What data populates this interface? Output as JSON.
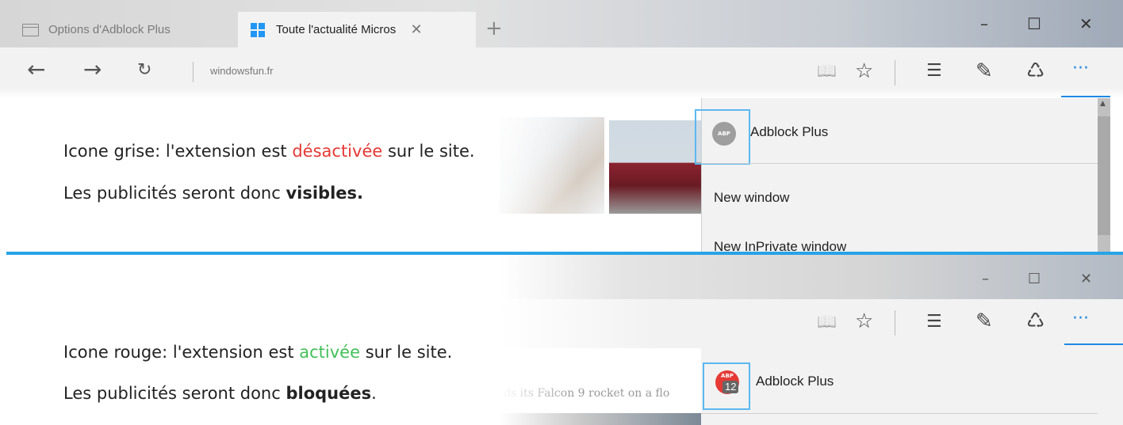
{
  "top_browser": {
    "tabs": [
      {
        "label": "Options d'Adblock Plus",
        "active": false
      },
      {
        "label": "Toute l'actualité Micros ",
        "active": true
      }
    ],
    "close_tab": "✕",
    "new_tab": "+",
    "window_controls": {
      "minimize": "–",
      "maximize": "☐",
      "close": "✕"
    },
    "nav": {
      "back": "←",
      "forward": "→",
      "refresh": "↻",
      "url": "windowsfun.fr"
    },
    "toolbar": {
      "reading_view": "📖",
      "favorite": "☆",
      "hub": "☰",
      "web_note": "✎",
      "share": "♺",
      "more": "···"
    }
  },
  "captions": {
    "top": {
      "line1_prefix": "Icone grise: l'extension est ",
      "line1_highlight": "désactivée",
      "line1_suffix": " sur le site.",
      "line2_prefix": "Les publicités seront donc ",
      "line2_bold": "visibles."
    },
    "bottom": {
      "line1_prefix": "Icone rouge: l'extension est ",
      "line1_highlight": "activée",
      "line1_suffix": " sur le site.",
      "line2_prefix": "Les publicités seront donc ",
      "line2_bold": "bloquées",
      "line2_suffix": "."
    }
  },
  "top_menu": {
    "extension_label": "Adblock Plus",
    "abp_icon_text": "ABP",
    "items": [
      "New window",
      "New InPrivate window"
    ]
  },
  "bottom_browser": {
    "window_controls": {
      "minimize": "–",
      "maximize": "☐",
      "close": "✕"
    },
    "toolbar": {
      "reading_view": "📖",
      "favorite": "☆",
      "hub": "☰",
      "web_note": "✎",
      "share": "♺",
      "more": "···"
    },
    "article_snippet": "ds its Falcon 9 rocket on a flo",
    "extension_label": "Adblock Plus",
    "abp_icon_text": "ABP",
    "blocked_count": "12"
  },
  "colors": {
    "accent": "#1e88e5",
    "divider": "#29a3e6",
    "disabled_word": "#e53935",
    "enabled_word": "#43c059"
  }
}
